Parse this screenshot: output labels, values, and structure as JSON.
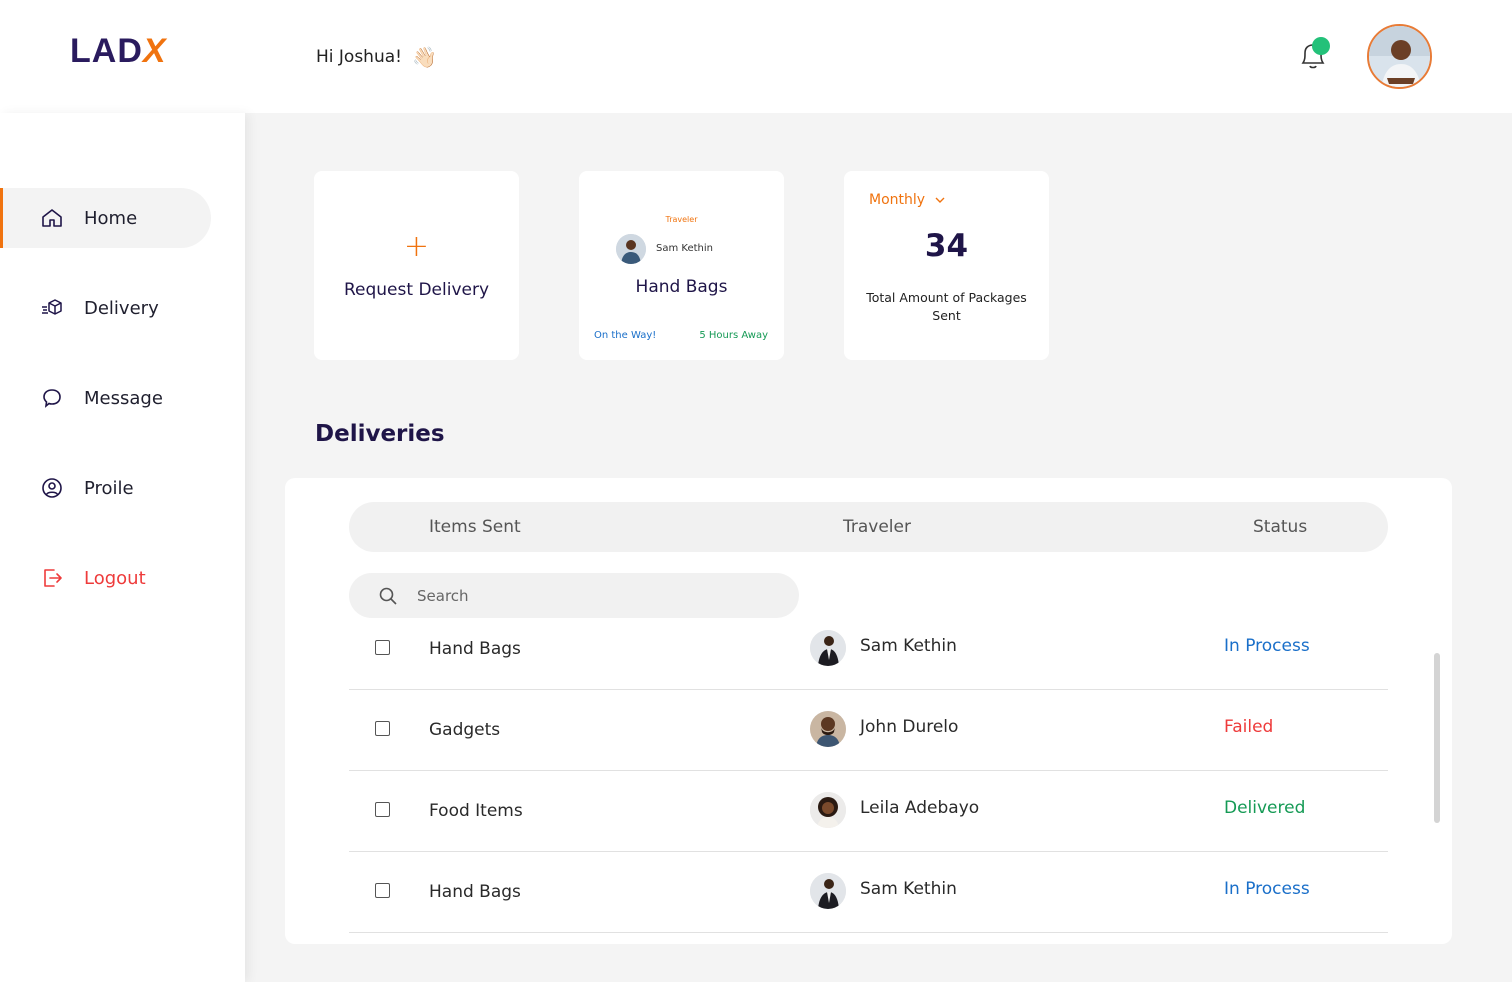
{
  "brand": {
    "name_main": "LAD",
    "name_accent": "X",
    "accent_color": "#f0730f",
    "primary_color": "#1f1548"
  },
  "header": {
    "greeting": "Hi Joshua!",
    "greeting_emoji": "👋🏻",
    "bell_icon": "bell-icon",
    "notification_dot_color": "#23c179"
  },
  "sidebar": {
    "items": [
      {
        "label": "Home",
        "icon": "home-icon",
        "active": true
      },
      {
        "label": "Delivery",
        "icon": "delivery-box-icon",
        "active": false
      },
      {
        "label": "Message",
        "icon": "chat-bubble-icon",
        "active": false
      },
      {
        "label": "Proile",
        "icon": "user-circle-icon",
        "active": false
      },
      {
        "label": "Logout",
        "icon": "logout-icon",
        "active": false
      }
    ]
  },
  "cards": {
    "request": {
      "plus": "+",
      "label": "Request Delivery"
    },
    "current": {
      "traveler_label": "Traveler",
      "traveler_name": "Sam Kethin",
      "item": "Hand Bags",
      "progress_text": "On the Way!",
      "eta": "5 Hours Away"
    },
    "stats": {
      "period": "Monthly",
      "count": "34",
      "description": "Total Amount of Packages Sent"
    }
  },
  "deliveries": {
    "title": "Deliveries",
    "columns": [
      "Items Sent",
      "Traveler",
      "Status"
    ],
    "search_placeholder": "Search",
    "rows": [
      {
        "item": "Hand Bags",
        "traveler": "Sam Kethin",
        "status": "In Process",
        "status_color": "#1a6fc9"
      },
      {
        "item": "Gadgets",
        "traveler": "John Durelo",
        "status": "Failed",
        "status_color": "#ee3b3b"
      },
      {
        "item": "Food Items",
        "traveler": "Leila Adebayo",
        "status": "Delivered",
        "status_color": "#159a55"
      },
      {
        "item": "Hand Bags",
        "traveler": "Sam Kethin",
        "status": "In Process",
        "status_color": "#1a6fc9"
      }
    ]
  }
}
